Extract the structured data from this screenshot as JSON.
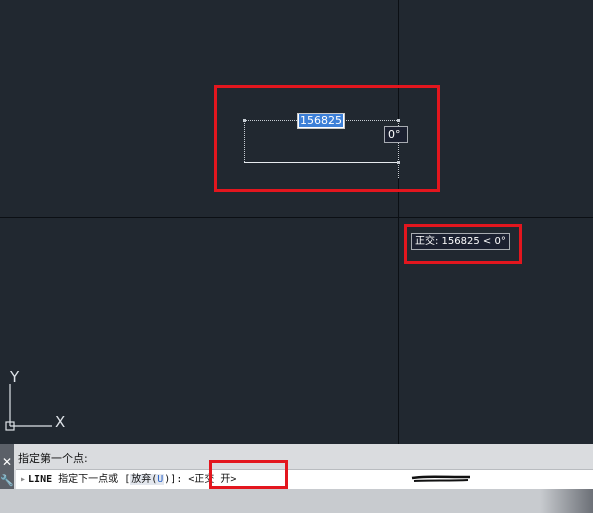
{
  "dynamic_input": {
    "length_value": "156825",
    "angle_value": "0°"
  },
  "ortho_tooltip": {
    "text": "正交: 156825 < 0°"
  },
  "ucs_icon": {
    "y_label": "Y",
    "x_label": "X"
  },
  "command_line": {
    "history": "指定第一个点:",
    "prompt_command": "LINE",
    "prompt_text": "指定下一点或",
    "option_open": "[",
    "option_label": "放弃(",
    "option_key": "U",
    "option_close": ")]:",
    "ortho_status": "<正交 开>",
    "close_glyph": "✕",
    "customize_glyph": "🔧",
    "recent_glyph": "▸"
  },
  "colors": {
    "canvas_bg": "#212830",
    "highlight_red": "#e3161e",
    "selection_blue": "#3c7fd7",
    "command_bg": "#dadcdf"
  },
  "icons": [
    "close-icon",
    "wrench-icon",
    "recent-commands-icon",
    "ucs-icon"
  ]
}
